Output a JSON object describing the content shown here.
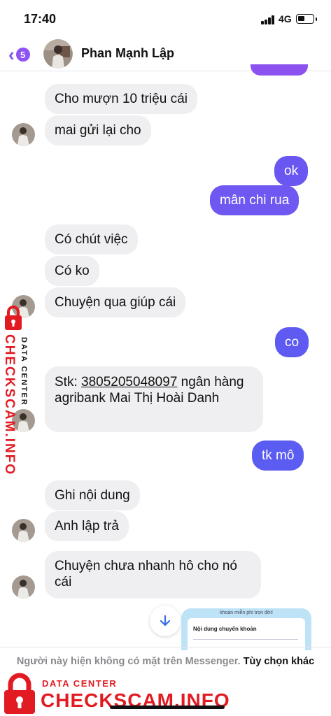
{
  "status_bar": {
    "time": "17:40",
    "network": "4G",
    "battery_level": 0.45
  },
  "header": {
    "back_badge": "5",
    "contact_name": "Phan Mạnh Lập",
    "avatar_icon": "contact-avatar"
  },
  "colors": {
    "accent": "#7b4cf2",
    "outgoing_start": "#8b52f0",
    "outgoing_end": "#5b5cf2",
    "incoming": "#efeff1",
    "watermark": "#e21b23"
  },
  "messages": [
    {
      "dir": "in",
      "text": "Cho mượn 10 triệu cái"
    },
    {
      "dir": "in",
      "text": "mai gửi lại cho"
    },
    {
      "dir": "out",
      "text": "ok"
    },
    {
      "dir": "out",
      "text": "mân chi rua"
    },
    {
      "dir": "in",
      "text": "Có chút việc"
    },
    {
      "dir": "in",
      "text": "Có ko"
    },
    {
      "dir": "in",
      "text": "Chuyện qua giúp cái"
    },
    {
      "dir": "out",
      "text": "co"
    },
    {
      "dir": "in",
      "prefix": "Stk: ",
      "number": "3805205048097",
      "suffix": " ngân hàng agribank Mai Thị Hoài Danh"
    },
    {
      "dir": "out",
      "text": "tk mô"
    },
    {
      "dir": "in",
      "text": "Ghi nội dung"
    },
    {
      "dir": "in",
      "text": "Anh lập trả"
    },
    {
      "dir": "in",
      "text": "Chuyện chưa nhanh hô cho nó cái"
    }
  ],
  "preview": {
    "caption": "khoản miễn phí trọn đời!",
    "label": "Nội dung chuyển khoản"
  },
  "footer": {
    "note": "Người này hiện không có mặt trên Messenger.",
    "link": "Tùy chọn khác"
  },
  "watermark": {
    "main": "CHECKSCAM.INFO",
    "sub": "DATA CENTER"
  }
}
